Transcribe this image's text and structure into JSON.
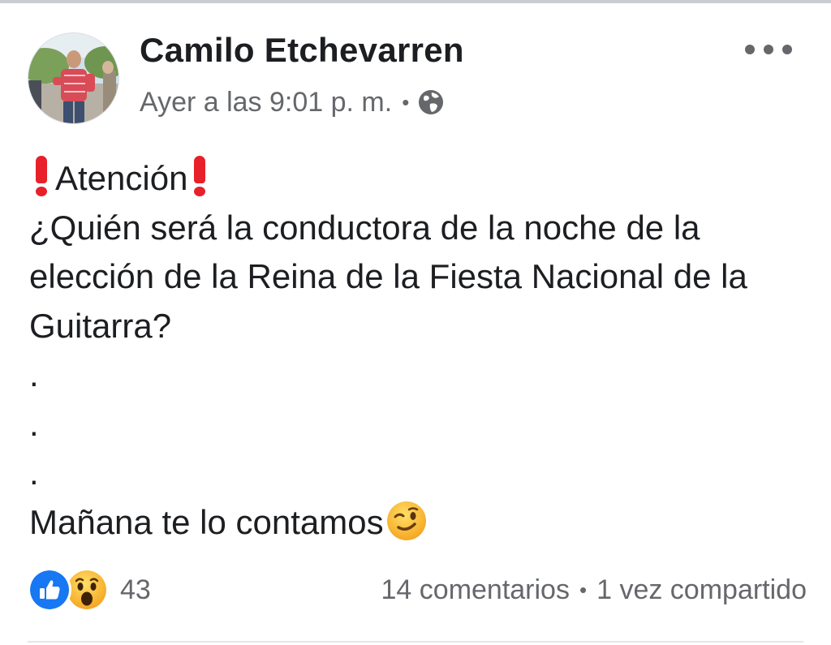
{
  "post": {
    "author": "Camilo Etchevarren",
    "timestamp": "Ayer a las 9:01 p. m.",
    "separator": "•",
    "privacy_icon": "globe-icon",
    "options_icon": "more-horizontal-icon",
    "body": {
      "heading": "Atención",
      "heading_emoji": "red-exclamation-mark",
      "lines": [
        "¿Quién será la conductora de la noche de la",
        "elección de la Reina de la Fiesta Nacional de la",
        "Guitarra?"
      ],
      "dots": [
        ".",
        ".",
        "."
      ],
      "closing": "Mañana te lo contamos",
      "closing_emoji": "winking-face"
    },
    "reactions": {
      "types": [
        "like-icon",
        "wow-icon"
      ],
      "count": "43"
    },
    "comments": "14 comentarios",
    "shares": "1 vez compartido"
  },
  "colors": {
    "text": "#1c1e21",
    "secondary_text": "#65676b",
    "like_blue": "#1877f2",
    "alert_red": "#e8202a",
    "emoji_yellow": "#f7b125"
  }
}
